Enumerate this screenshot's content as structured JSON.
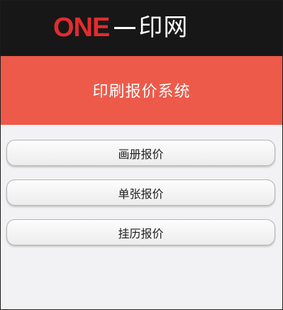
{
  "brand": {
    "latin": "ONE",
    "chinese": "印网"
  },
  "header": {
    "title": "印刷报价系统"
  },
  "menu": {
    "items": [
      {
        "label": "画册报价"
      },
      {
        "label": "单张报价"
      },
      {
        "label": "挂历报价"
      }
    ]
  },
  "colors": {
    "topbar": "#171717",
    "brand_red": "#e32b2e",
    "header_bg": "#ee5a4a",
    "page_bg": "#f2f1f3"
  }
}
